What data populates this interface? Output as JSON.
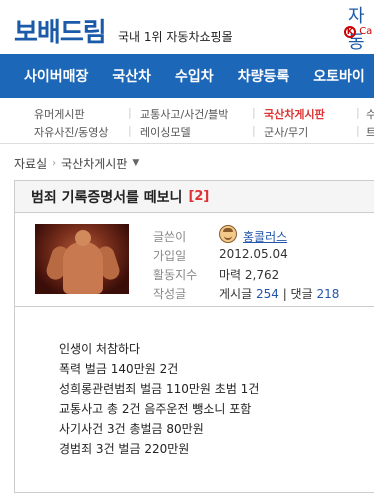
{
  "header": {
    "logo": "보배드림",
    "tagline": "국내 1위 자동차쇼핑몰",
    "topright_text": "자동",
    "topright_sub": "Ca"
  },
  "main_nav": [
    "사이버매장",
    "국산차",
    "수입차",
    "차량등록",
    "오토바이"
  ],
  "sub_nav": {
    "row1": [
      "유머게시판",
      "교통사고/사건/블박",
      "국산차게시판",
      "수"
    ],
    "row2": [
      "자유사진/동영상",
      "레이싱모델",
      "군사/무기",
      "트"
    ],
    "active": "국산차게시판"
  },
  "breadcrumb": {
    "home": "자료실",
    "current": "국산차게시판"
  },
  "post": {
    "title": "범죄 기록증명서를 떼보니",
    "comment_count": "[2]",
    "author": {
      "writer_label": "글쓴이",
      "nickname": "홍콜러스",
      "joined_label": "가입일",
      "joined_value": "2012.05.04",
      "activity_label": "활동지수",
      "activity_value": "마력 2,762",
      "posts_label": "작성글",
      "posts_prefix": "게시글",
      "posts_count": "254",
      "comments_prefix": "| 댓글",
      "comments_count": "218"
    },
    "body_lines": [
      "인생이 처참하다",
      "폭력 벌금 140만원 2건",
      "성희롱관련범죄 벌금 110만원 초범 1건",
      "교통사고 총 2건 음주운전 뺑소니 포함",
      "사기사건 3건 총벌금 80만원",
      "경범죄 3건 벌금 220만원"
    ]
  },
  "colors": {
    "brand_blue": "#1d67b8",
    "accent_red": "#d33"
  }
}
